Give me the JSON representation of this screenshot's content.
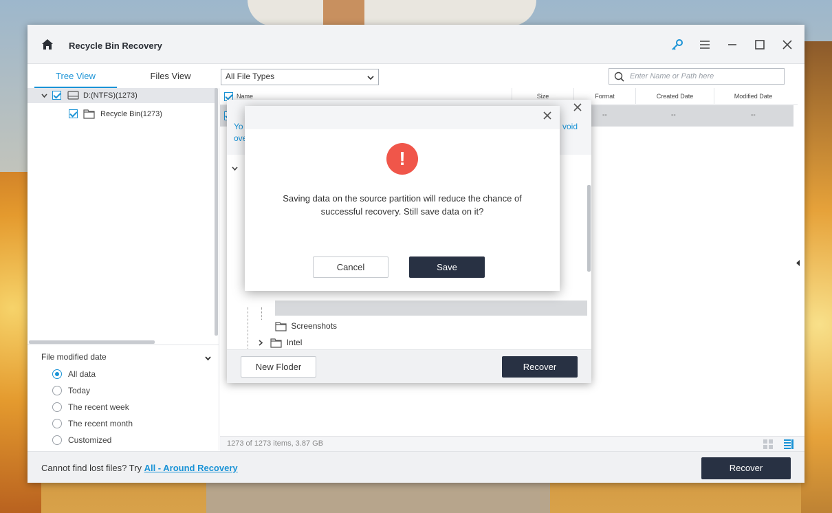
{
  "app": {
    "title": "Recycle Bin Recovery"
  },
  "tabs": {
    "tree_view": "Tree View",
    "files_view": "Files View"
  },
  "filetype": {
    "selected": "All File Types"
  },
  "search": {
    "placeholder": "Enter Name or Path here"
  },
  "tree": {
    "drive_label": "D:(NTFS)(1273)",
    "recycle_label": "Recycle Bin(1273)"
  },
  "filter": {
    "title": "File modified date",
    "options": [
      "All data",
      "Today",
      "The recent week",
      "The recent month",
      "Customized"
    ],
    "selected_index": 0
  },
  "list": {
    "columns": {
      "name": "Name",
      "size": "Size",
      "format": "Format",
      "created": "Created Date",
      "modified": "Modified Date"
    },
    "row": {
      "format": "--",
      "created": "--",
      "modified": "--"
    }
  },
  "status": {
    "count_text": "1273 of 1273 items, 3.87 GB"
  },
  "bottom": {
    "prompt": "Cannot find lost files? Try ",
    "link": "All - Around Recovery",
    "recover_label": "Recover"
  },
  "save_dialog": {
    "hint_line1_start": "Yo",
    "hint_line1_end": "void",
    "hint_line2_start": "ove",
    "folders": [
      {
        "label": "Screenshots"
      },
      {
        "label": "Intel"
      }
    ],
    "new_folder_label": "New Floder",
    "recover_label": "Recover"
  },
  "confirm": {
    "message": "Saving data on the source partition will reduce the chance of successful recovery. Still save data on it?",
    "cancel_label": "Cancel",
    "save_label": "Save",
    "alert_glyph": "!"
  },
  "colors": {
    "accent": "#1a93d6",
    "dark_button": "#283143",
    "alert": "#f0564a"
  }
}
